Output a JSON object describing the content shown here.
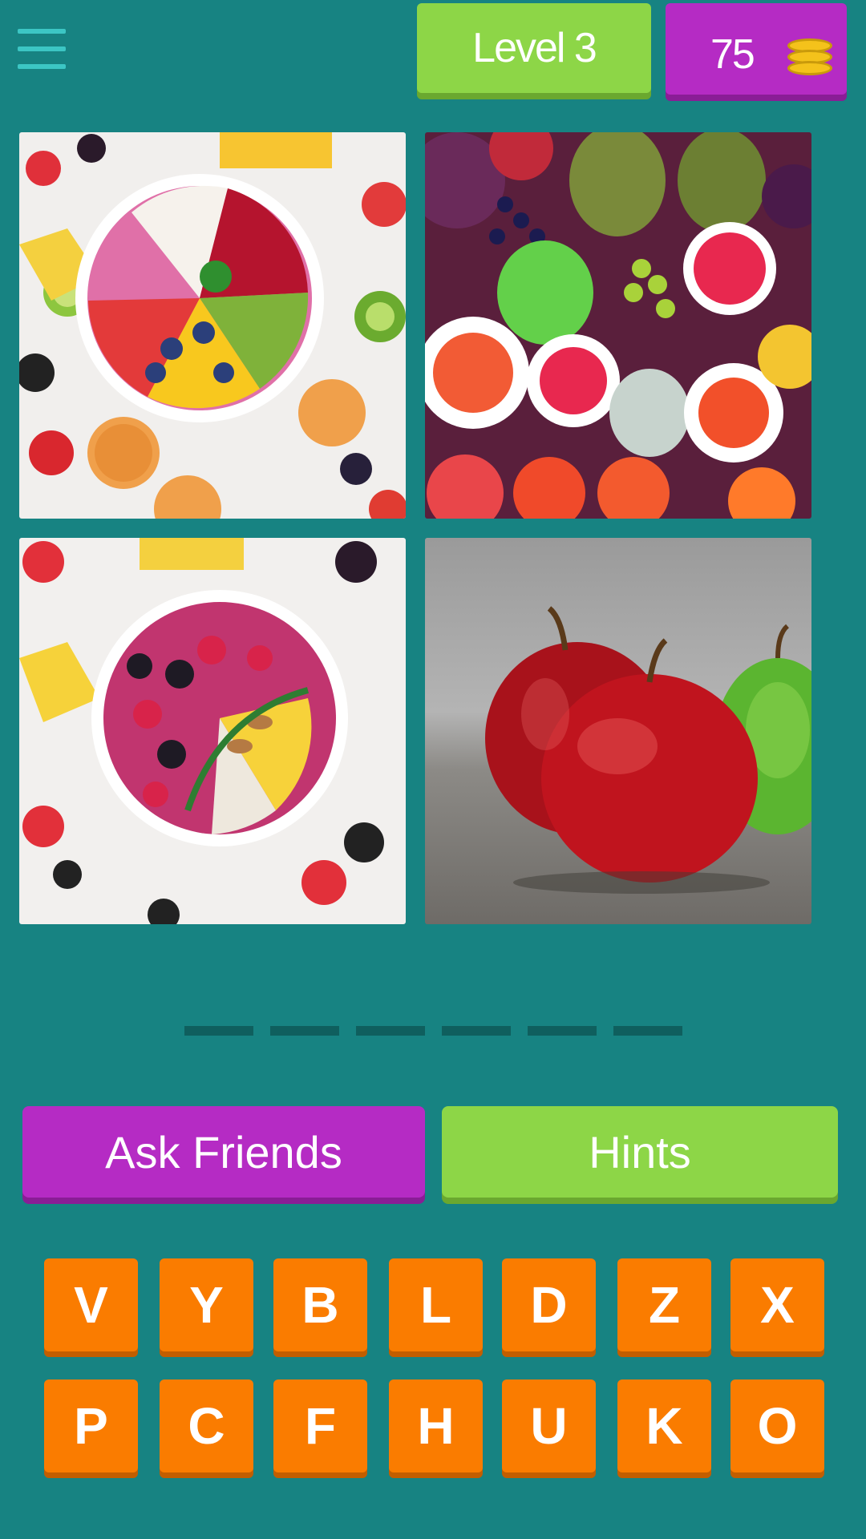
{
  "header": {
    "level_label": "Level 3",
    "coins": "75"
  },
  "puzzle": {
    "images": [
      {
        "subject": "fruit smoothie bowl with strawberries, blueberries, pomegranate and kiwi"
      },
      {
        "subject": "assorted colorful fruits pile"
      },
      {
        "subject": "smoothie bowl with raspberries, blackberries, almonds and mango"
      },
      {
        "subject": "red and green apples"
      }
    ],
    "answer_slots": 6
  },
  "actions": {
    "ask_friends": "Ask Friends",
    "hints": "Hints"
  },
  "keyboard": {
    "row1": [
      "V",
      "Y",
      "B",
      "L",
      "D",
      "Z",
      "X"
    ],
    "row2": [
      "P",
      "C",
      "F",
      "H",
      "U",
      "K",
      "O"
    ]
  },
  "colors": {
    "background": "#178382",
    "green_button": "#8dd647",
    "purple_button": "#b52bc4",
    "letter_key": "#fa7c00"
  }
}
